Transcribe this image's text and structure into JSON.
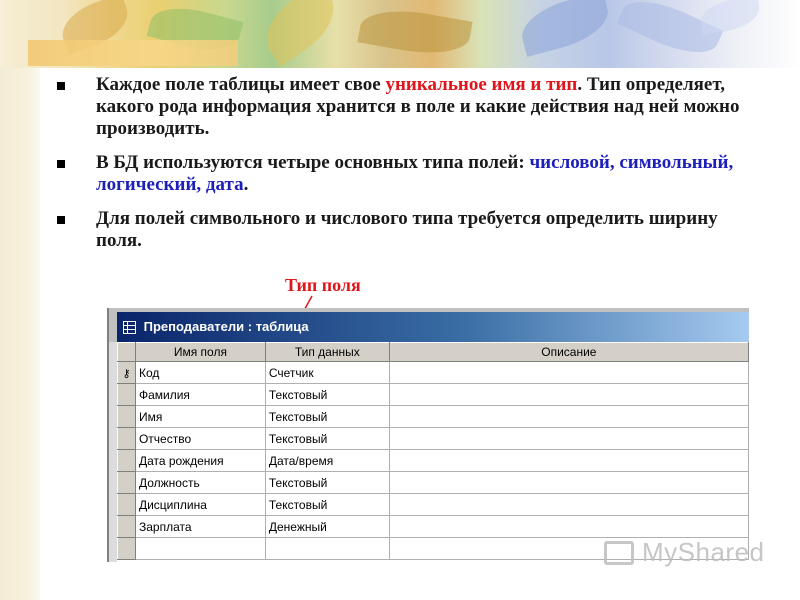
{
  "slide": {
    "bullets": [
      {
        "parts": [
          {
            "text": "Каждое поле таблицы имеет свое ",
            "color": "black"
          },
          {
            "text": "уникальное имя и тип",
            "color": "red"
          },
          {
            "text": ". Тип определяет, какого рода информация хранится в поле и какие действия над ней можно производить.",
            "color": "black"
          }
        ]
      },
      {
        "parts": [
          {
            "text": "В БД используются четыре основных типа полей: ",
            "color": "black"
          },
          {
            "text": "числовой, символьный, логический, дата",
            "color": "blue"
          },
          {
            "text": ".",
            "color": "black"
          }
        ]
      },
      {
        "parts": [
          {
            "text": "Для полей символьного и числового типа требуется определить ширину поля.",
            "color": "black"
          }
        ]
      }
    ],
    "callout": "Тип поля",
    "colors": {
      "accent_red": "#e0151a",
      "accent_blue": "#1c1fb8"
    }
  },
  "table_window": {
    "title": "Преподаватели : таблица",
    "icon": "table-icon",
    "columns": [
      "Имя поля",
      "Тип данных",
      "Описание"
    ],
    "rows": [
      {
        "field": "Код",
        "type": "Счетчик",
        "description": "",
        "primary_key": true
      },
      {
        "field": "Фамилия",
        "type": "Текстовый",
        "description": ""
      },
      {
        "field": "Имя",
        "type": "Текстовый",
        "description": ""
      },
      {
        "field": "Отчество",
        "type": "Текстовый",
        "description": ""
      },
      {
        "field": "Дата рождения",
        "type": "Дата/время",
        "description": ""
      },
      {
        "field": "Должность",
        "type": "Текстовый",
        "description": ""
      },
      {
        "field": "Дисциплина",
        "type": "Текстовый",
        "description": ""
      },
      {
        "field": "Зарплата",
        "type": "Денежный",
        "description": ""
      },
      {
        "field": "",
        "type": "",
        "description": ""
      }
    ]
  },
  "watermark": {
    "text": "MyShared",
    "icon": "presentation-screen-icon"
  }
}
